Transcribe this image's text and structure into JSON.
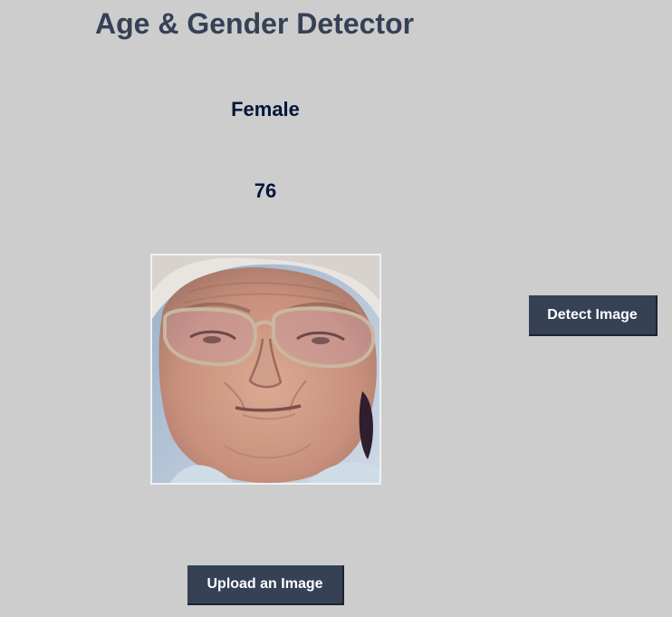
{
  "app": {
    "title": "Age & Gender Detector"
  },
  "result": {
    "gender": "Female",
    "age": "76"
  },
  "buttons": {
    "detect_label": "Detect Image",
    "upload_label": "Upload an Image"
  },
  "colors": {
    "background": "#cdcdcd",
    "heading": "#364156",
    "result_text": "#011638",
    "button_bg": "#364156",
    "button_text": "#ffffff"
  }
}
